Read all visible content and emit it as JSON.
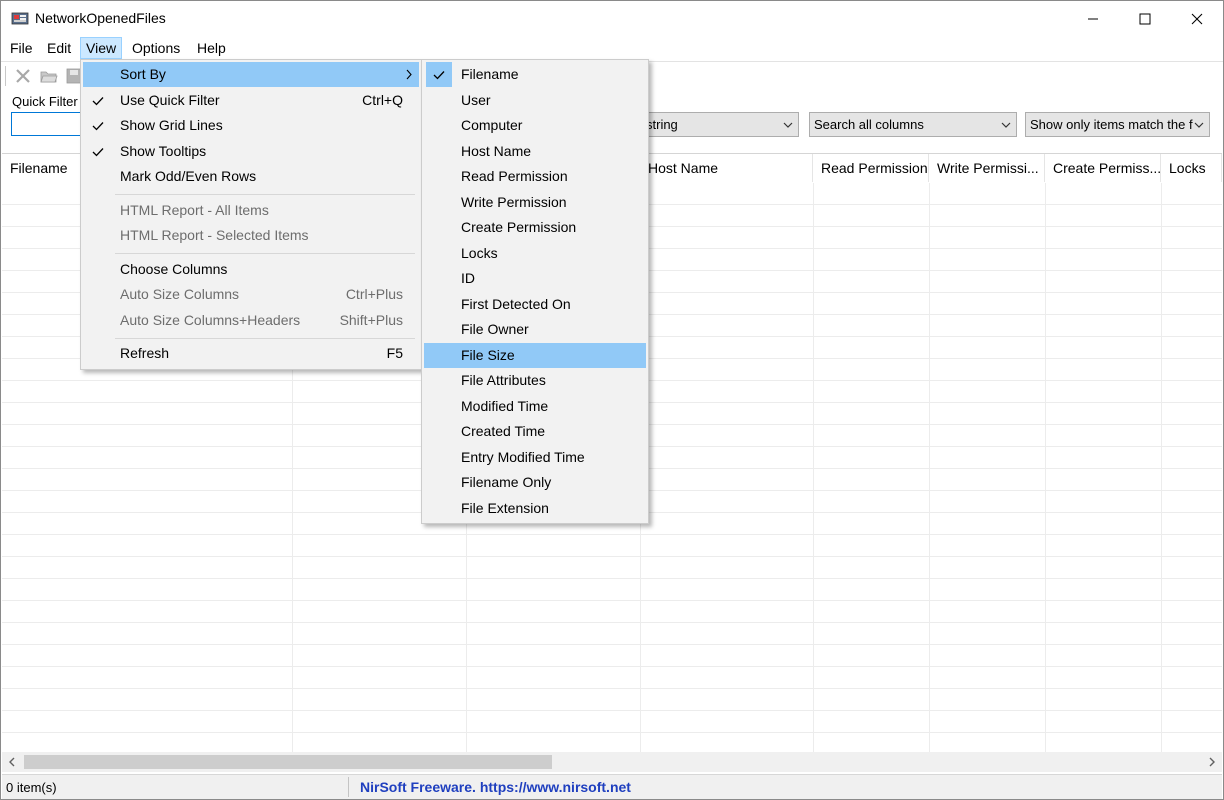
{
  "window": {
    "title": "NetworkOpenedFiles"
  },
  "menubar": {
    "items": [
      "File",
      "Edit",
      "View",
      "Options",
      "Help"
    ],
    "active": "View"
  },
  "quick_filter": {
    "label": "Quick Filter",
    "value": "",
    "combo1": "string",
    "combo2": "Search all columns",
    "combo3": "Show only items match the f"
  },
  "columns": [
    "Filename",
    "Host Name",
    "Read Permission",
    "Write Permissi...",
    "Create Permiss...",
    "Locks"
  ],
  "view_menu": {
    "sort_by": "Sort By",
    "use_quick_filter": "Use Quick Filter",
    "use_quick_filter_shortcut": "Ctrl+Q",
    "show_grid_lines": "Show Grid Lines",
    "show_tooltips": "Show Tooltips",
    "mark_odd_even": "Mark Odd/Even Rows",
    "html_all": "HTML Report - All Items",
    "html_selected": "HTML Report - Selected Items",
    "choose_columns": "Choose Columns",
    "auto_size": "Auto Size Columns",
    "auto_size_shortcut": "Ctrl+Plus",
    "auto_size_headers": "Auto Size Columns+Headers",
    "auto_size_headers_shortcut": "Shift+Plus",
    "refresh": "Refresh",
    "refresh_shortcut": "F5"
  },
  "sort_menu": {
    "items": [
      "Filename",
      "User",
      "Computer",
      "Host Name",
      "Read Permission",
      "Write Permission",
      "Create Permission",
      "Locks",
      "ID",
      "First Detected On",
      "File Owner",
      "File Size",
      "File Attributes",
      "Modified Time",
      "Created Time",
      "Entry Modified Time",
      "Filename Only",
      "File Extension"
    ],
    "checked": "Filename",
    "highlighted": "File Size"
  },
  "statusbar": {
    "count": "0 item(s)",
    "link": "NirSoft Freeware. https://www.nirsoft.net"
  },
  "colors": {
    "highlight": "#91c9f7",
    "menu_bg": "#f2f2f2",
    "link": "#1f3fbf"
  }
}
